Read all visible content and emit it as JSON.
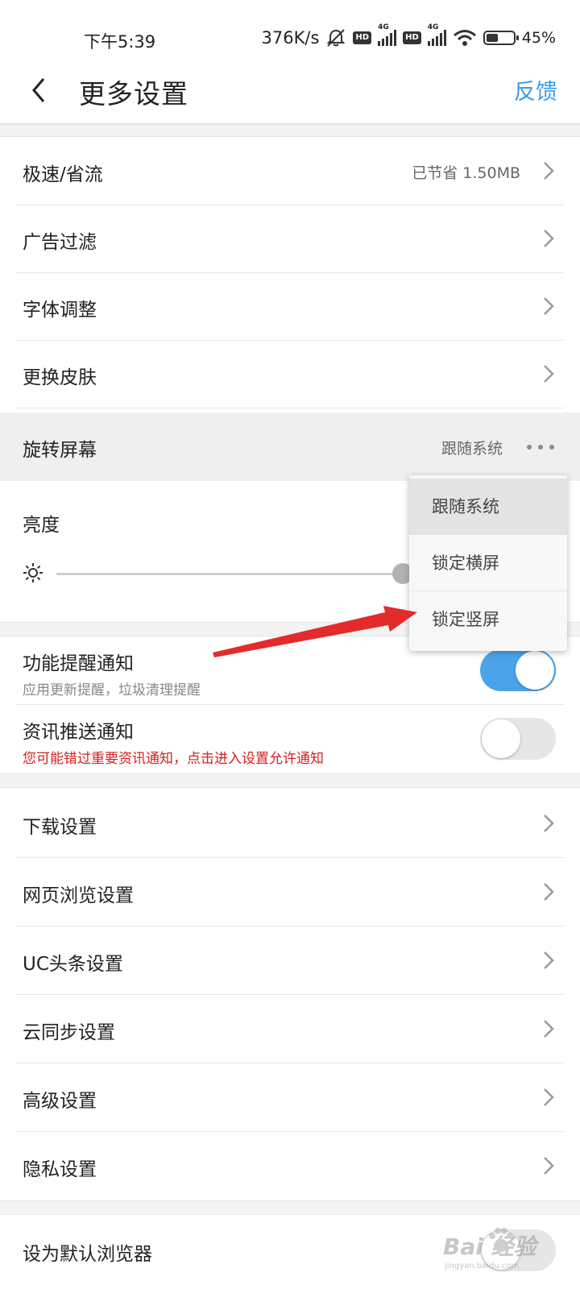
{
  "status_bar": {
    "time": "下午5:39",
    "speed": "376K/s",
    "network1": "4G",
    "network2": "4G",
    "hd_label": "HD",
    "battery_percent": "45%",
    "battery_level": 0.45,
    "icons": [
      "mute-icon",
      "signal-icon",
      "wifi-icon",
      "battery-icon"
    ]
  },
  "header": {
    "title": "更多设置",
    "feedback": "反馈",
    "accent_color": "#3d9ae6"
  },
  "group1": [
    {
      "label": "极速/省流",
      "value": "已节省 1.50MB"
    },
    {
      "label": "广告过滤",
      "value": ""
    },
    {
      "label": "字体调整",
      "value": ""
    },
    {
      "label": "更换皮肤",
      "value": ""
    }
  ],
  "rotate": {
    "label": "旋转屏幕",
    "value": "跟随系统"
  },
  "brightness": {
    "label": "亮度",
    "level": 1.0
  },
  "notifications": [
    {
      "label": "功能提醒通知",
      "sub": "应用更新提醒，垃圾清理提醒",
      "on": true
    },
    {
      "label": "资讯推送通知",
      "sub": "您可能错过重要资讯通知，点击进入设置允许通知",
      "on": false,
      "warn_color": "#d4201e"
    }
  ],
  "group2": [
    {
      "label": "下载设置"
    },
    {
      "label": "网页浏览设置"
    },
    {
      "label": "UC头条设置"
    },
    {
      "label": "云同步设置"
    },
    {
      "label": "高级设置"
    },
    {
      "label": "隐私设置"
    }
  ],
  "default_browser": {
    "label": "设为默认浏览器",
    "on": false
  },
  "popup": {
    "options": [
      "跟随系统",
      "锁定横屏",
      "锁定竖屏"
    ],
    "selected": "跟随系统"
  },
  "watermark": {
    "text": "Bai 经验",
    "url": "jingyan.baidu.com"
  }
}
